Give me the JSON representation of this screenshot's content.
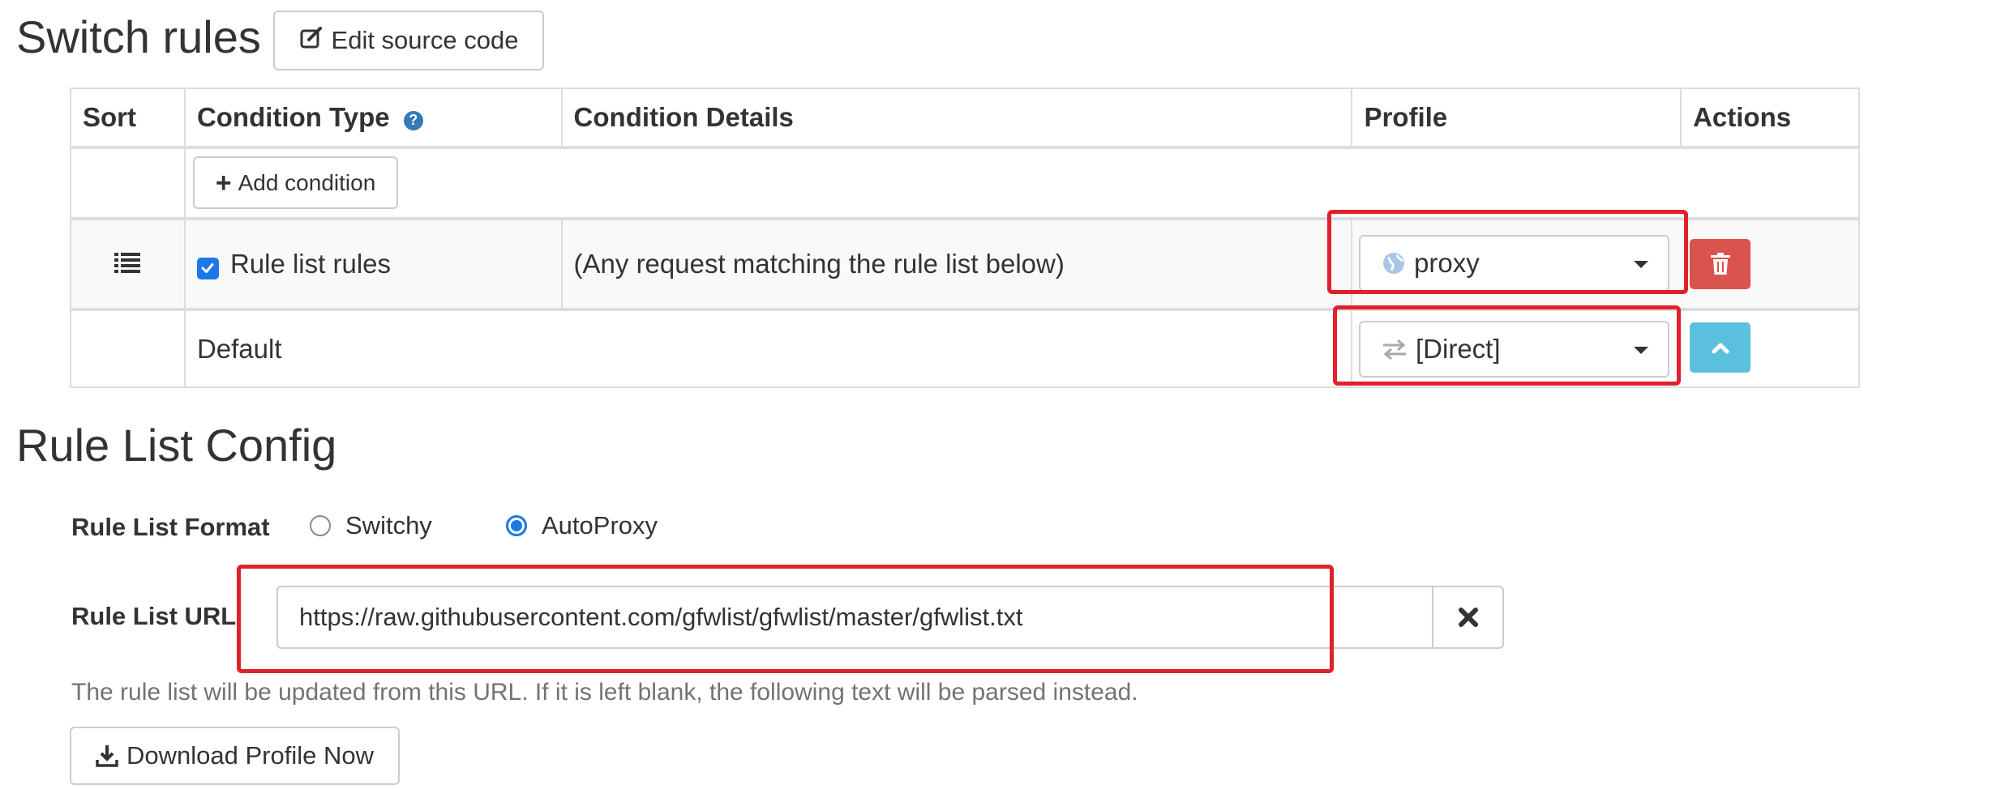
{
  "switch_rules": {
    "title": "Switch rules",
    "edit_source_label": "Edit source code",
    "columns": {
      "sort": "Sort",
      "condition_type": "Condition Type",
      "condition_details": "Condition Details",
      "profile": "Profile",
      "actions": "Actions"
    },
    "add_condition_label": "Add condition",
    "rule_row": {
      "checked": true,
      "condition_type": "Rule list rules",
      "condition_details": "(Any request matching the rule list below)",
      "profile": "proxy",
      "profile_icon": "globe-icon"
    },
    "default_row": {
      "condition_type": "Default",
      "profile": "[Direct]",
      "profile_icon": "transfer-arrows-icon"
    },
    "colors": {
      "delete_button": "#d9534f",
      "move_button": "#5bc0de",
      "highlight": "#e1202d",
      "help_icon": "#337ab7"
    }
  },
  "rule_list_config": {
    "title": "Rule List Config",
    "format_label": "Rule List Format",
    "format_options": [
      "Switchy",
      "AutoProxy"
    ],
    "format_selected": "AutoProxy",
    "url_label": "Rule List URL",
    "url_value": "https://raw.githubusercontent.com/gfwlist/gfwlist/master/gfwlist.txt",
    "help_text": "The rule list will be updated from this URL. If it is left blank, the following text will be parsed instead.",
    "download_label": "Download Profile Now"
  }
}
